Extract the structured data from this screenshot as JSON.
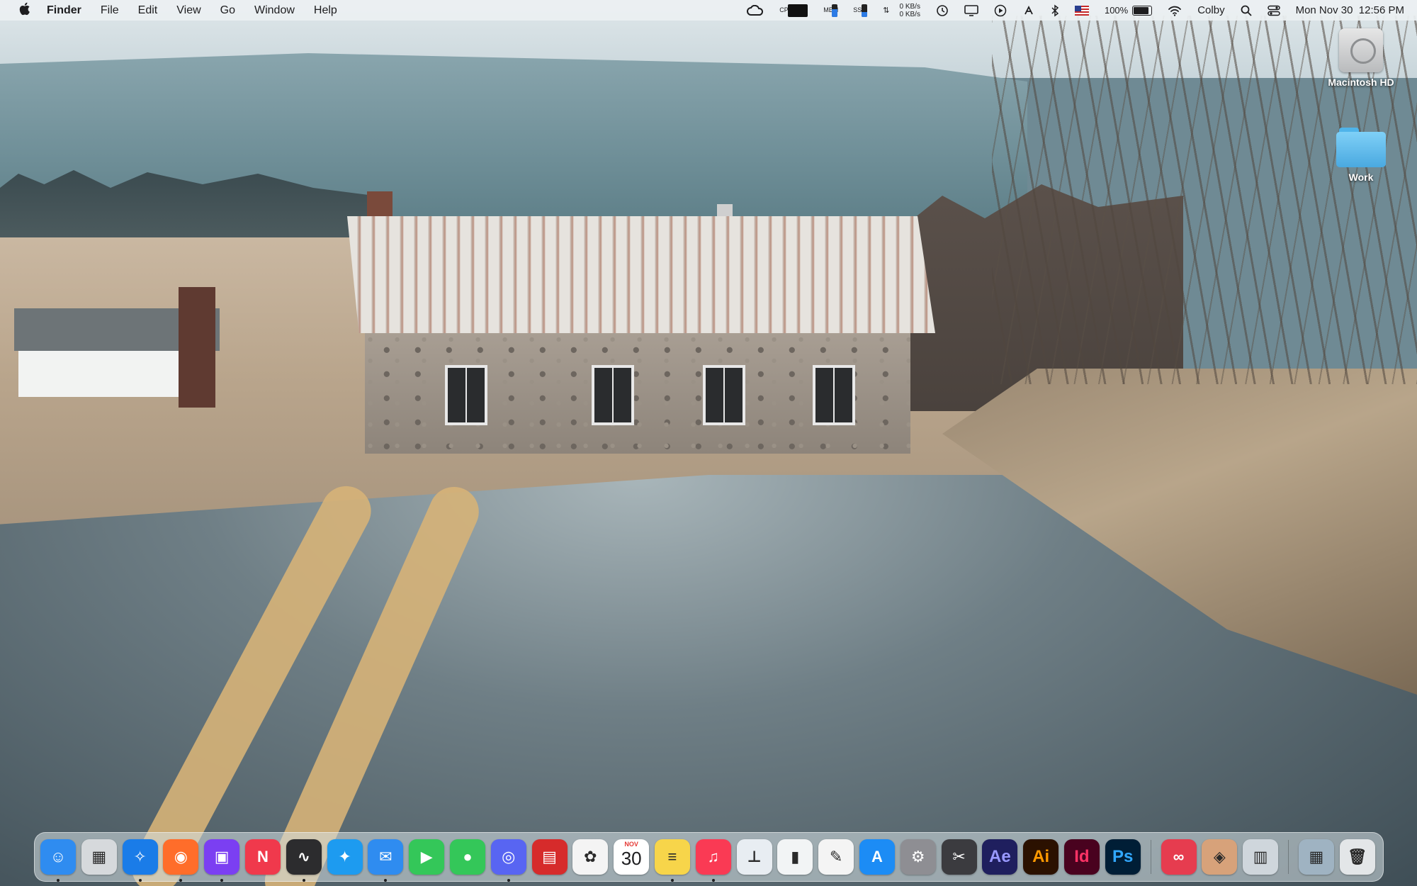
{
  "menubar": {
    "apple_icon": "apple-logo-icon",
    "app_name": "Finder",
    "menus": [
      "File",
      "Edit",
      "View",
      "Go",
      "Window",
      "Help"
    ],
    "status": {
      "cpu_label": "CPU",
      "mem_label": "MEM",
      "ssd_label": "SSD",
      "net_up": "0 KB/s",
      "net_down": "0 KB/s",
      "battery_percent": "100%",
      "battery_level": 1.0,
      "user": "Colby",
      "datetime": "Mon Nov 30  12:56 PM"
    }
  },
  "desktop": {
    "icons": [
      {
        "label": "Macintosh HD",
        "icon": "hard-drive-icon"
      },
      {
        "label": "Work",
        "icon": "folder-icon"
      }
    ]
  },
  "dock": {
    "calendar": {
      "month": "NOV",
      "day": "30"
    },
    "apps": [
      {
        "name": "finder",
        "glyph": "☺",
        "color": "#2f8cf0",
        "running": true
      },
      {
        "name": "launchpad",
        "glyph": "▦",
        "color": "#d6d9dc",
        "running": false
      },
      {
        "name": "safari",
        "glyph": "✧",
        "color": "#1a7ce8",
        "running": true
      },
      {
        "name": "firefox",
        "glyph": "◉",
        "color": "#ff6d2a",
        "running": true
      },
      {
        "name": "twitch",
        "glyph": "▣",
        "color": "#7b3ff2",
        "running": true
      },
      {
        "name": "news",
        "glyph": "N",
        "color": "#f0394c",
        "running": false
      },
      {
        "name": "activity-monitor",
        "glyph": "∿",
        "color": "#2c2c2e",
        "running": true
      },
      {
        "name": "twitter",
        "glyph": "✦",
        "color": "#1d9bf0",
        "running": false
      },
      {
        "name": "mail",
        "glyph": "✉",
        "color": "#2f8cf0",
        "running": true
      },
      {
        "name": "facetime",
        "glyph": "▶",
        "color": "#34c759",
        "running": false
      },
      {
        "name": "messages",
        "glyph": "●",
        "color": "#34c759",
        "running": false
      },
      {
        "name": "discord",
        "glyph": "◎",
        "color": "#5865f2",
        "running": true
      },
      {
        "name": "photo-booth",
        "glyph": "▤",
        "color": "#d62b2b",
        "running": false
      },
      {
        "name": "photos",
        "glyph": "✿",
        "color": "#f4f4f4",
        "running": false
      },
      {
        "name": "calendar",
        "glyph": "",
        "color": "#ffffff",
        "running": false
      },
      {
        "name": "notes",
        "glyph": "≡",
        "color": "#f7d54a",
        "running": true
      },
      {
        "name": "music",
        "glyph": "♫",
        "color": "#fa3a54",
        "running": true
      },
      {
        "name": "keynote",
        "glyph": "⊥",
        "color": "#e8edf2",
        "running": false
      },
      {
        "name": "numbers",
        "glyph": "▮",
        "color": "#f2f4f5",
        "running": false
      },
      {
        "name": "pages",
        "glyph": "✎",
        "color": "#f4f4f4",
        "running": false
      },
      {
        "name": "app-store",
        "glyph": "A",
        "color": "#1c8cf5",
        "running": false
      },
      {
        "name": "system-preferences",
        "glyph": "⚙",
        "color": "#8e8e93",
        "running": false
      },
      {
        "name": "final-cut-pro",
        "glyph": "✂",
        "color": "#3b3b3f",
        "running": false
      },
      {
        "name": "after-effects",
        "glyph": "Ae",
        "color": "#1f1f5e",
        "running": false
      },
      {
        "name": "illustrator",
        "glyph": "Ai",
        "color": "#2b1100",
        "running": false
      },
      {
        "name": "indesign",
        "glyph": "Id",
        "color": "#49021f",
        "running": false
      },
      {
        "name": "photoshop",
        "glyph": "Ps",
        "color": "#001e36",
        "running": false
      }
    ],
    "extras": [
      {
        "name": "creative-cloud",
        "glyph": "∞",
        "color": "#e63c4f"
      },
      {
        "name": "installer",
        "glyph": "◈",
        "color": "#d7a27a"
      },
      {
        "name": "preview",
        "glyph": "▥",
        "color": "#cfd6dc"
      }
    ],
    "right": [
      {
        "name": "downloads-stack",
        "glyph": "▦",
        "color": "#9fb3c2"
      },
      {
        "name": "trash",
        "glyph": "🗑",
        "color": "#e3e6e8"
      }
    ]
  }
}
